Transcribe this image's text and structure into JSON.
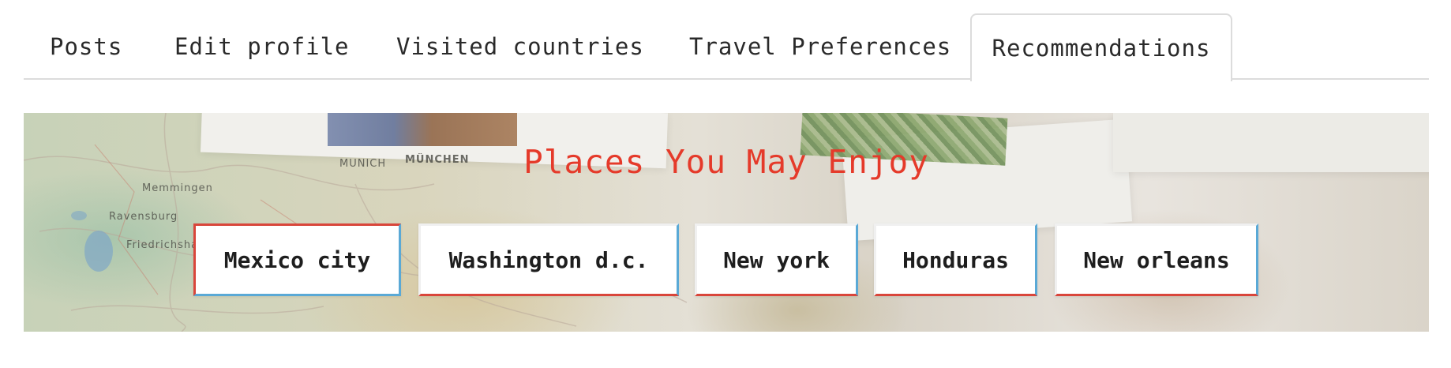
{
  "tabs": [
    {
      "label": "Posts",
      "active": false
    },
    {
      "label": "Edit profile",
      "active": false
    },
    {
      "label": "Visited countries",
      "active": false
    },
    {
      "label": "Travel Preferences",
      "active": false
    },
    {
      "label": "Recommendations",
      "active": true
    }
  ],
  "banner": {
    "title": "Places You May Enjoy",
    "title_color": "#e53a2a",
    "map_labels": [
      "MUNICH",
      "MÜNCHEN",
      "Memmingen",
      "Ravensburg",
      "Friedrichshafen"
    ]
  },
  "recommendations": [
    {
      "label": "Mexico city"
    },
    {
      "label": "Washington d.c."
    },
    {
      "label": "New york"
    },
    {
      "label": "Honduras"
    },
    {
      "label": "New orleans"
    }
  ],
  "colors": {
    "card_border_red": "#d9463b",
    "card_border_blue": "#5aa9d6",
    "tab_border": "#dcdcdc"
  }
}
